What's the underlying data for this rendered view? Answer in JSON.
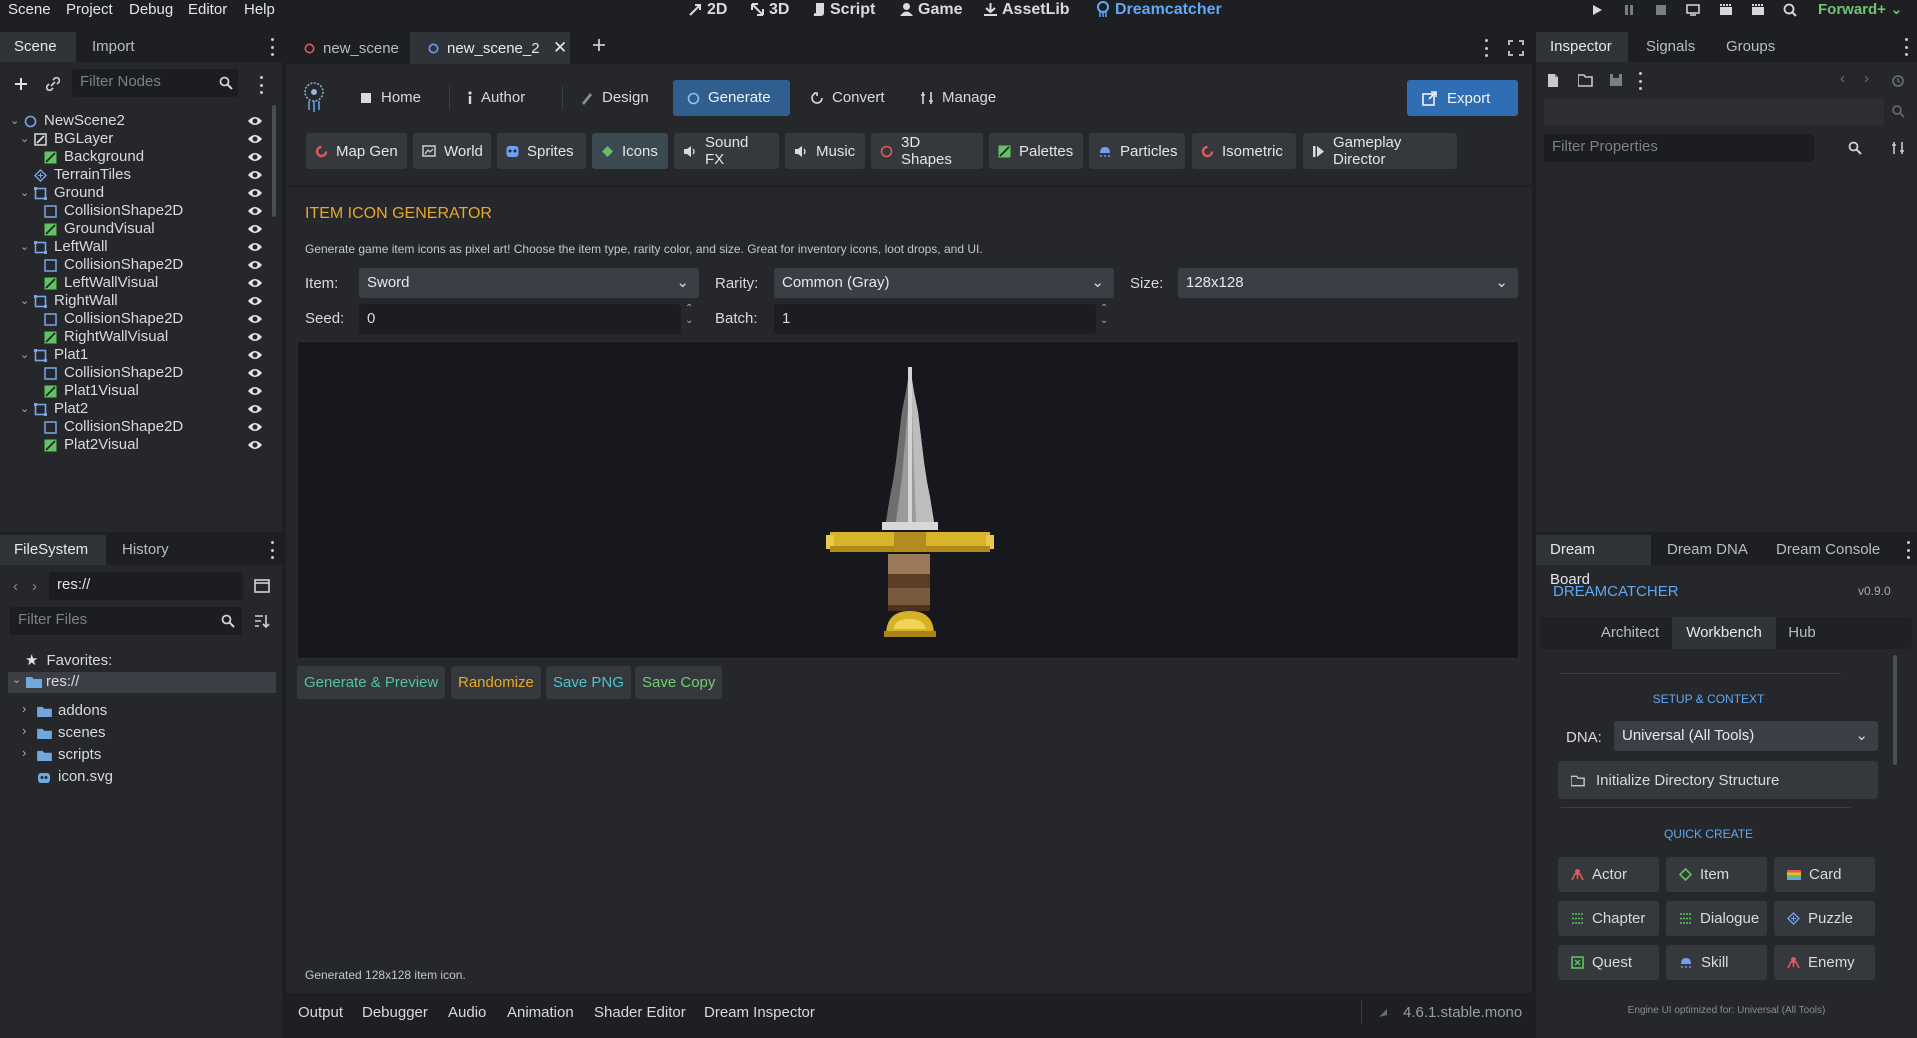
{
  "menu": [
    "Scene",
    "Project",
    "Debug",
    "Editor",
    "Help"
  ],
  "workspaces": [
    "2D",
    "3D",
    "Script",
    "Game",
    "AssetLib",
    "Dreamcatcher"
  ],
  "renderer": "Forward+",
  "scene_dock": {
    "tabs": [
      "Scene",
      "Import"
    ],
    "filter_placeholder": "Filter Nodes",
    "nodes": [
      {
        "label": "NewScene2",
        "depth": 0,
        "type": "node2d",
        "expanded": true
      },
      {
        "label": "BGLayer",
        "depth": 1,
        "type": "canvaslayer",
        "expanded": true
      },
      {
        "label": "Background",
        "depth": 2,
        "type": "colorrect"
      },
      {
        "label": "TerrainTiles",
        "depth": 1,
        "type": "tilemap"
      },
      {
        "label": "Ground",
        "depth": 1,
        "type": "staticbody",
        "expanded": true
      },
      {
        "label": "CollisionShape2D",
        "depth": 2,
        "type": "collision"
      },
      {
        "label": "GroundVisual",
        "depth": 2,
        "type": "colorrect"
      },
      {
        "label": "LeftWall",
        "depth": 1,
        "type": "staticbody",
        "expanded": true
      },
      {
        "label": "CollisionShape2D",
        "depth": 2,
        "type": "collision"
      },
      {
        "label": "LeftWallVisual",
        "depth": 2,
        "type": "colorrect"
      },
      {
        "label": "RightWall",
        "depth": 1,
        "type": "staticbody",
        "expanded": true
      },
      {
        "label": "CollisionShape2D",
        "depth": 2,
        "type": "collision"
      },
      {
        "label": "RightWallVisual",
        "depth": 2,
        "type": "colorrect"
      },
      {
        "label": "Plat1",
        "depth": 1,
        "type": "staticbody",
        "expanded": true
      },
      {
        "label": "CollisionShape2D",
        "depth": 2,
        "type": "collision"
      },
      {
        "label": "Plat1Visual",
        "depth": 2,
        "type": "colorrect"
      },
      {
        "label": "Plat2",
        "depth": 1,
        "type": "staticbody",
        "expanded": true
      },
      {
        "label": "CollisionShape2D",
        "depth": 2,
        "type": "collision"
      },
      {
        "label": "Plat2Visual",
        "depth": 2,
        "type": "colorrect"
      }
    ]
  },
  "filesystem_dock": {
    "tabs": [
      "FileSystem",
      "History"
    ],
    "path": "res://",
    "filter_placeholder": "Filter Files",
    "favorites_label": "Favorites:",
    "root_label": "res://",
    "items": [
      "addons",
      "scenes",
      "scripts",
      "icon.svg"
    ]
  },
  "scene_tabs": [
    "new_scene",
    "new_scene_2"
  ],
  "dc_nav": [
    "Home",
    "Author",
    "Design",
    "Generate",
    "Convert",
    "Manage"
  ],
  "export_label": "Export",
  "subtabs": [
    "Map Gen",
    "World",
    "Sprites",
    "Icons",
    "Sound FX",
    "Music",
    "3D Shapes",
    "Palettes",
    "Particles",
    "Isometric",
    "Gameplay Director"
  ],
  "generator": {
    "title": "ITEM ICON GENERATOR",
    "description": "Generate game item icons as pixel art! Choose the item type, rarity color, and size. Great for inventory icons, loot drops, and UI.",
    "item_label": "Item:",
    "item_value": "Sword",
    "rarity_label": "Rarity:",
    "rarity_value": "Common (Gray)",
    "size_label": "Size:",
    "size_value": "128x128",
    "seed_label": "Seed:",
    "seed_value": "0",
    "batch_label": "Batch:",
    "batch_value": "1",
    "buttons": [
      "Generate & Preview",
      "Randomize",
      "Save PNG",
      "Save Copy"
    ],
    "status": "Generated 128x128 item icon.",
    "colors": {
      "title": "#e6a92a",
      "generate": "#55c29a",
      "randomize": "#e6a92a",
      "save_png": "#4fc3c8",
      "save_copy": "#6fd06f"
    }
  },
  "bottom_tabs": [
    "Output",
    "Debugger",
    "Audio",
    "Animation",
    "Shader Editor",
    "Dream Inspector"
  ],
  "version": "4.6.1.stable.mono",
  "inspector": {
    "tabs": [
      "Inspector",
      "Signals",
      "Groups"
    ],
    "filter_placeholder": "Filter Properties"
  },
  "dream_dock": {
    "tabs": [
      "Dream Board",
      "Dream DNA",
      "Dream Console"
    ],
    "title": "DREAMCATCHER",
    "version": "v0.9.0",
    "subtabs": [
      "Architect",
      "Workbench",
      "Hub"
    ],
    "setup_heading": "SETUP & CONTEXT",
    "dna_label": "DNA:",
    "dna_value": "Universal (All Tools)",
    "init_label": "Initialize Directory Structure",
    "quick_heading": "QUICK CREATE",
    "quick": [
      "Actor",
      "Item",
      "Card",
      "Chapter",
      "Dialogue",
      "Puzzle",
      "Quest",
      "Skill",
      "Enemy"
    ],
    "footer": "Engine UI optimized for: Universal (All Tools)"
  }
}
